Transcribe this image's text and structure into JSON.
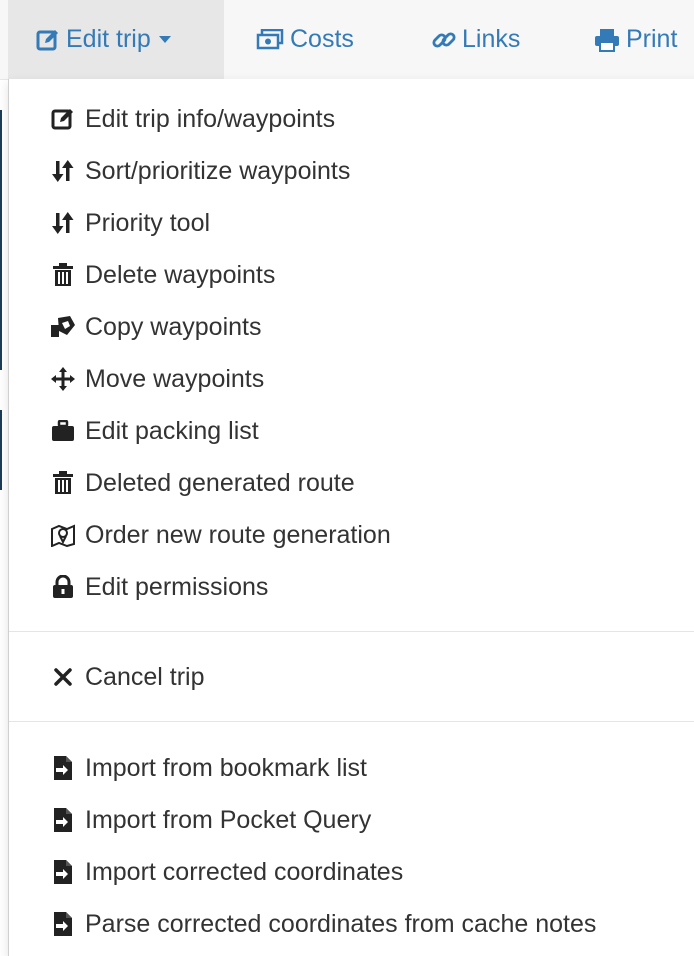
{
  "navbar": {
    "items": [
      {
        "label": "Edit trip",
        "icon": "edit-icon"
      },
      {
        "label": "Costs",
        "icon": "money-icon"
      },
      {
        "label": "Links",
        "icon": "link-icon"
      },
      {
        "label": "Print",
        "icon": "print-icon"
      }
    ]
  },
  "dropdown": {
    "items": [
      {
        "label": "Edit trip info/waypoints",
        "icon": "edit-icon"
      },
      {
        "label": "Sort/prioritize waypoints",
        "icon": "sort-icon"
      },
      {
        "label": "Priority tool",
        "icon": "sort-icon"
      },
      {
        "label": "Delete waypoints",
        "icon": "trash-icon"
      },
      {
        "label": "Copy waypoints",
        "icon": "copy-icon"
      },
      {
        "label": "Move waypoints",
        "icon": "move-icon"
      },
      {
        "label": "Edit packing list",
        "icon": "briefcase-icon"
      },
      {
        "label": "Deleted generated route",
        "icon": "trash-icon"
      },
      {
        "label": "Order new route generation",
        "icon": "map-icon"
      },
      {
        "label": "Edit permissions",
        "icon": "lock-icon"
      },
      {
        "label": "Cancel trip",
        "icon": "close-icon"
      },
      {
        "label": "Import from bookmark list",
        "icon": "file-import-icon"
      },
      {
        "label": "Import from Pocket Query",
        "icon": "file-import-icon"
      },
      {
        "label": "Import corrected coordinates",
        "icon": "file-import-icon"
      },
      {
        "label": "Parse corrected coordinates from cache notes",
        "icon": "file-import-icon"
      }
    ]
  },
  "colors": {
    "link": "#337ab7",
    "text": "#333333",
    "navbar_bg": "#f7f7f7",
    "active_bg": "#e7e7e7"
  }
}
